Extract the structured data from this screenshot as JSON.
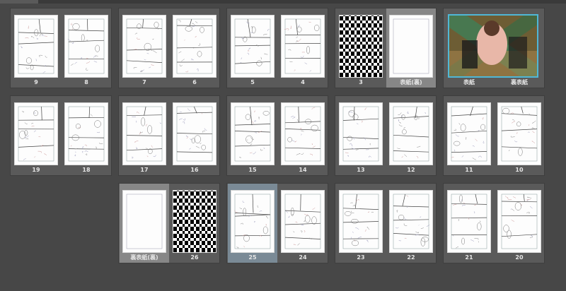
{
  "rows": [
    {
      "spreads": [
        {
          "left": {
            "label": "9",
            "type": "sketch"
          },
          "right": {
            "label": "8",
            "type": "sketch"
          }
        },
        {
          "left": {
            "label": "7",
            "type": "sketch"
          },
          "right": {
            "label": "6",
            "type": "sketch"
          }
        },
        {
          "left": {
            "label": "5",
            "type": "sketch"
          },
          "right": {
            "label": "4",
            "type": "sketch"
          }
        },
        {
          "left": {
            "label": "3",
            "type": "stripes"
          },
          "right": {
            "label": "表紙(裏)",
            "type": "blank",
            "selected": true
          }
        },
        {
          "cover": true,
          "left": {
            "label": "表紙"
          },
          "right": {
            "label": "裏表紙"
          }
        }
      ]
    },
    {
      "spreads": [
        {
          "left": {
            "label": "19",
            "type": "sketch"
          },
          "right": {
            "label": "18",
            "type": "sketch"
          }
        },
        {
          "left": {
            "label": "17",
            "type": "sketch"
          },
          "right": {
            "label": "16",
            "type": "sketch"
          }
        },
        {
          "left": {
            "label": "15",
            "type": "sketch"
          },
          "right": {
            "label": "14",
            "type": "sketch"
          }
        },
        {
          "left": {
            "label": "13",
            "type": "sketch"
          },
          "right": {
            "label": "12",
            "type": "sketch"
          }
        },
        {
          "left": {
            "label": "11",
            "type": "sketch"
          },
          "right": {
            "label": "10",
            "type": "sketch"
          }
        }
      ]
    },
    {
      "spreads": [
        {
          "left": {
            "label": "裏表紙(裏)",
            "type": "blank",
            "selected": true
          },
          "right": {
            "label": "26",
            "type": "stripes"
          }
        },
        {
          "left": {
            "label": "25",
            "type": "sketch",
            "selected_blue": true
          },
          "right": {
            "label": "24",
            "type": "sketch"
          }
        },
        {
          "left": {
            "label": "23",
            "type": "sketch"
          },
          "right": {
            "label": "22",
            "type": "sketch"
          }
        },
        {
          "left": {
            "label": "21",
            "type": "sketch"
          },
          "right": {
            "label": "20",
            "type": "sketch"
          }
        }
      ]
    }
  ],
  "colors": {
    "background": "#474747",
    "spread_bg": "#5a5a5a",
    "selected_page": "#878787",
    "selected_blue": "#7a8a96",
    "cover_border": "#4fb7d6"
  }
}
